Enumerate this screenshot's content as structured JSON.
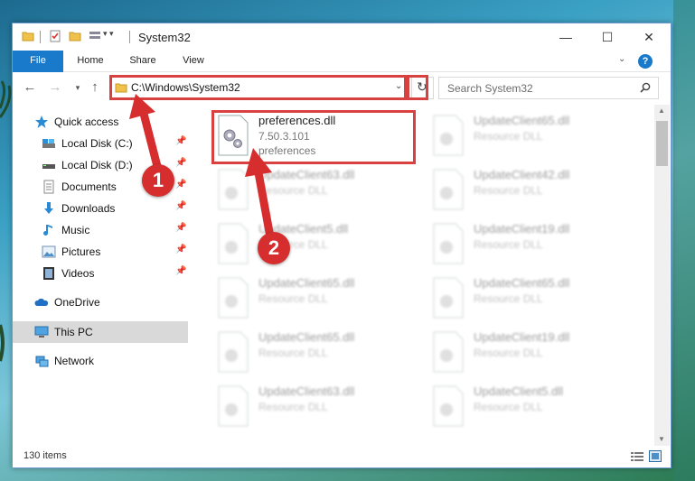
{
  "window": {
    "title": "System32",
    "controls": {
      "minimize": "—",
      "maximize": "☐",
      "close": "✕"
    }
  },
  "ribbon": {
    "tabs": [
      "File",
      "Home",
      "Share",
      "View"
    ],
    "help": "?"
  },
  "nav": {
    "address": "C:\\Windows\\System32",
    "search_placeholder": "Search System32"
  },
  "sidebar": {
    "items": [
      {
        "label": "Quick access",
        "icon": "star-icon"
      },
      {
        "label": "Local Disk (C:)",
        "icon": "drive-icon"
      },
      {
        "label": "Local Disk (D:)",
        "icon": "drive-icon"
      },
      {
        "label": "Documents",
        "icon": "documents-icon"
      },
      {
        "label": "Downloads",
        "icon": "downloads-icon"
      },
      {
        "label": "Music",
        "icon": "music-icon"
      },
      {
        "label": "Pictures",
        "icon": "pictures-icon"
      },
      {
        "label": "Videos",
        "icon": "videos-icon"
      },
      {
        "label": "OneDrive",
        "icon": "onedrive-icon"
      },
      {
        "label": "This PC",
        "icon": "computer-icon"
      },
      {
        "label": "Network",
        "icon": "network-icon"
      }
    ]
  },
  "files": [
    {
      "name": "preferences.dll",
      "line2": "7.50.3.101",
      "line3": "preferences"
    },
    {
      "name": "UpdateClient65.dll",
      "line2": "Resource DLL"
    },
    {
      "name": "UpdateClient63.dll",
      "line2": "Resource DLL"
    },
    {
      "name": "UpdateClient42.dll",
      "line2": "Resource DLL"
    },
    {
      "name": "UpdateClient5.dll",
      "line2": "Resource DLL"
    },
    {
      "name": "UpdateClient19.dll",
      "line2": "Resource DLL"
    },
    {
      "name": "UpdateClient65.dll",
      "line2": "Resource DLL"
    },
    {
      "name": "UpdateClient65.dll",
      "line2": "Resource DLL"
    },
    {
      "name": "UpdateClient65.dll",
      "line2": "Resource DLL"
    },
    {
      "name": "UpdateClient19.dll",
      "line2": "Resource DLL"
    },
    {
      "name": "UpdateClient63.dll",
      "line2": "Resource DLL"
    },
    {
      "name": "UpdateClient5.dll",
      "line2": "Resource DLL"
    }
  ],
  "status": {
    "items": "130 items"
  },
  "annotations": {
    "step1": "1",
    "step2": "2",
    "color": "#d62e2e"
  }
}
